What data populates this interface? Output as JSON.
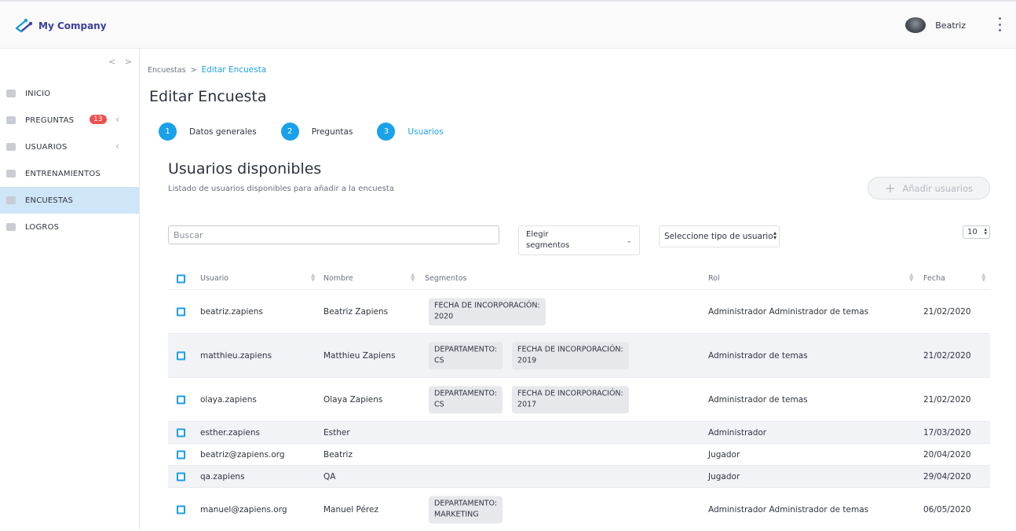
{
  "header": {
    "brand": "My Company",
    "user_name": "Beatriz"
  },
  "sidebar": {
    "collapse": "< >",
    "items": [
      {
        "label": "INICIO",
        "icon": "home-icon"
      },
      {
        "label": "PREGUNTAS",
        "icon": "questions-icon",
        "badge": "13",
        "chevron": "‹"
      },
      {
        "label": "USUARIOS",
        "icon": "users-icon",
        "chevron": "‹"
      },
      {
        "label": "ENTRENAMIENTOS",
        "icon": "graduation-icon"
      },
      {
        "label": "ENCUESTAS",
        "icon": "survey-icon",
        "active": true
      },
      {
        "label": "LOGROS",
        "icon": "trophy-icon"
      }
    ]
  },
  "breadcrumb": {
    "parent": "Encuestas",
    "sep": ">",
    "current": "Editar Encuesta"
  },
  "page_title": "Editar Encuesta",
  "steps": [
    {
      "num": "1",
      "label": "Datos generales"
    },
    {
      "num": "2",
      "label": "Preguntas"
    },
    {
      "num": "3",
      "label": "Usuarios"
    }
  ],
  "section": {
    "title": "Usuarios disponibles",
    "subtitle": "Listado de usuarios disponibles para añadir a la encuesta",
    "add_button": "Añadir usuarios",
    "add_plus": "+"
  },
  "filters": {
    "search_placeholder": "Buscar",
    "segment_line1": "Elegir",
    "segment_line2": "segmentos",
    "segment_chev": "⌄",
    "role_placeholder": "Seleccione tipo de usuario",
    "page_size": "10",
    "arrows": "▴▾"
  },
  "table": {
    "columns": [
      "Usuario",
      "Nombre",
      "Segmentos",
      "Rol",
      "Fecha"
    ],
    "rows": [
      {
        "usuario": "beatriz.zapiens",
        "nombre": "Beatriz Zapiens",
        "segmentos": [
          [
            "FECHA DE INCORPORACIÓN:",
            "2020"
          ]
        ],
        "rol": "Administrador Administrador de temas",
        "fecha": "21/02/2020"
      },
      {
        "usuario": "matthieu.zapiens",
        "nombre": "Matthieu Zapiens",
        "segmentos": [
          [
            "DEPARTAMENTO:",
            "CS"
          ],
          [
            "FECHA DE INCORPORACIÓN:",
            "2019"
          ]
        ],
        "rol": "Administrador de temas",
        "fecha": "21/02/2020"
      },
      {
        "usuario": "olaya.zapiens",
        "nombre": "Olaya Zapiens",
        "segmentos": [
          [
            "DEPARTAMENTO:",
            "CS"
          ],
          [
            "FECHA DE INCORPORACIÓN:",
            "2017"
          ]
        ],
        "rol": "Administrador de temas",
        "fecha": "21/02/2020"
      },
      {
        "usuario": "esther.zapiens",
        "nombre": "Esther",
        "segmentos": [],
        "rol": "Administrador",
        "fecha": "17/03/2020"
      },
      {
        "usuario": "beatriz@zapiens.org",
        "nombre": "Beatriz",
        "segmentos": [],
        "rol": "Jugador",
        "fecha": "20/04/2020"
      },
      {
        "usuario": "qa.zapiens",
        "nombre": "QA",
        "segmentos": [],
        "rol": "Jugador",
        "fecha": "29/04/2020"
      },
      {
        "usuario": "manuel@zapiens.org",
        "nombre": "Manuel Pérez",
        "segmentos": [
          [
            "DEPARTAMENTO:",
            "MARKETING"
          ]
        ],
        "rol": "Administrador Administrador de temas",
        "fecha": "06/05/2020"
      }
    ]
  },
  "colors": {
    "accent": "#19a1ea",
    "brand": "#3c3f9b",
    "badge": "#f05050",
    "active_nav": "#cfe6f8"
  }
}
